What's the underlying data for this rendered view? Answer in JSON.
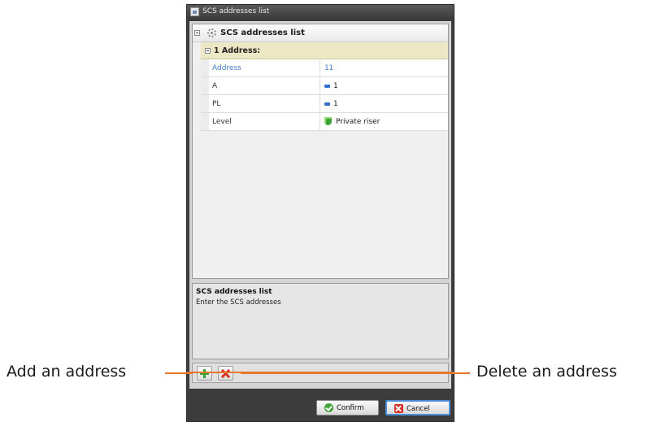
{
  "window": {
    "title": "SCS addresses list"
  },
  "tree": {
    "root_label": "SCS addresses list",
    "category_label": "1 Address:",
    "rows": [
      {
        "name": "Address",
        "value": "11",
        "icon": "none",
        "selected": true
      },
      {
        "name": "A",
        "value": "1",
        "icon": "blue-square-icon"
      },
      {
        "name": "PL",
        "value": "1",
        "icon": "blue-square-icon"
      },
      {
        "name": "Level",
        "value": "Private riser",
        "icon": "green-shield-icon"
      }
    ]
  },
  "description": {
    "title": "SCS addresses list",
    "text": "Enter the SCS addresses"
  },
  "buttons": {
    "confirm": "Confirm",
    "cancel": "Cancel"
  },
  "callouts": {
    "add": "Add an address",
    "delete": "Delete an address"
  },
  "colors": {
    "accent": "#e8762c",
    "selected_text": "#3f7fc6"
  }
}
